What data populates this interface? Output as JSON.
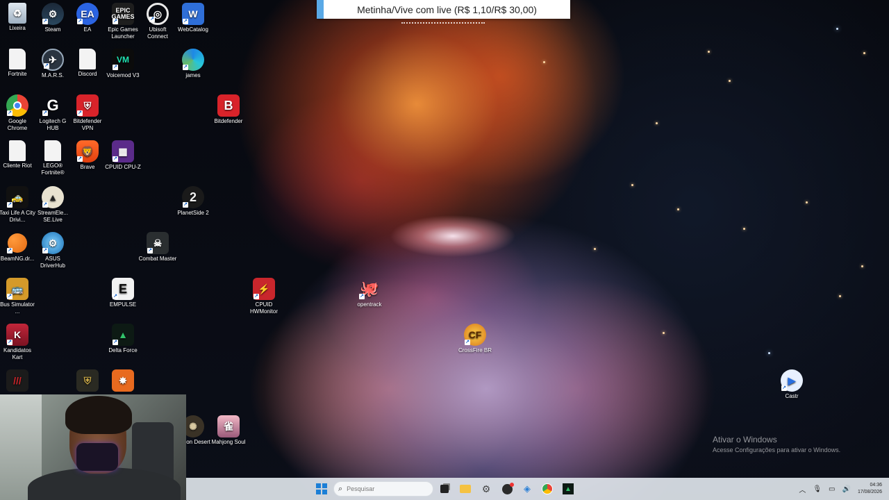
{
  "notification": {
    "text": "Metinha/Vive com live (R$ 1,10/R$ 30,00)"
  },
  "desktop": {
    "icons": {
      "lixeira": "Lixeira",
      "steam": "Steam",
      "ea": "EA",
      "epic": "Epic Games Launcher",
      "ubisoft": "Ubisoft Connect",
      "webcatalog": "WebCatalog",
      "fortnite": "Fortnite",
      "mars": "M.A.R.S.",
      "discord": "Discord",
      "voicemod": "Voicemod V3",
      "james": "james",
      "chrome": "Google Chrome",
      "logitech": "Logitech G HUB",
      "bitdefender_vpn": "Bitdefender VPN",
      "bitdefender": "Bitdefender",
      "riot": "Cliente Riot",
      "lego": "LEGO® Fortnite®",
      "brave": "Brave",
      "cpuz": "CPUID CPU-Z",
      "taxi": "Taxi Life A City Drivi...",
      "streamelements": "StreamEle... SE.Live",
      "planetside": "PlanetSide 2",
      "beamng": "BeamNG.dr...",
      "asus": "ASUS DriverHub",
      "combat": "Combat Master",
      "bus": "Bus Simulator ...",
      "empulse": "EMPULSE",
      "hwmonitor": "CPUID HWMonitor",
      "opentrack": "opentrack",
      "kandidatos": "Kandidatos Kart",
      "delta": "Delta Force",
      "crossfire": "CrossFire BR",
      "castr": "Castr",
      "crimson": "rimson Desert",
      "mahjong": "Mahjong Soul"
    }
  },
  "watermark": {
    "title": "Ativar o Windows",
    "subtitle": "Acesse Configurações para ativar o Windows."
  },
  "taskbar": {
    "search_placeholder": "Pesquisar",
    "time": "04:36",
    "date": "17/08/2026"
  },
  "colors": {
    "accent": "#1c7fd6",
    "notification_stripe": "#5aa9e6"
  }
}
